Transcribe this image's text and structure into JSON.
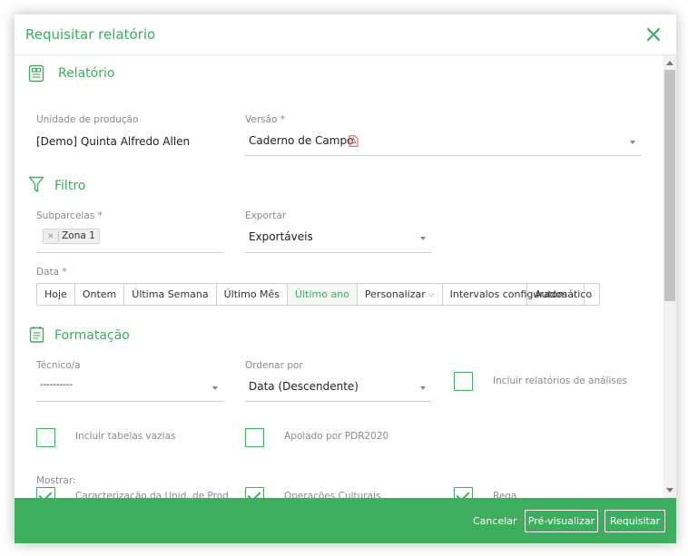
{
  "dialog": {
    "title": "Requisitar relatório"
  },
  "sections": {
    "relatorio": {
      "title": "Relatório",
      "unidade": {
        "label": "Unidade de produção",
        "value": "[Demo] Quinta Alfredo Allen"
      },
      "versao": {
        "label": "Versão *",
        "value": "Caderno de Campo"
      }
    },
    "filtro": {
      "title": "Filtro",
      "subparcelas": {
        "label": "Subparcelas *",
        "chip": "Zona 1"
      },
      "exportar": {
        "label": "Exportar",
        "value": "Exportáveis"
      },
      "data": {
        "label": "Data *",
        "buttons": [
          "Hoje",
          "Ontem",
          "Última Semana",
          "Último Mês",
          "Último ano",
          "Personalizar",
          "Intervalos configurados"
        ],
        "active": "Último ano",
        "auto": "Automático"
      }
    },
    "formatacao": {
      "title": "Formatação",
      "tecnico": {
        "label": "Técnico/a",
        "value": "----------"
      },
      "ordenar": {
        "label": "Ordenar por",
        "value": "Data (Descendente)"
      },
      "incluir_analises": "Incluir relatórios de análises",
      "incluir_tabelas": "Incluir tabelas vazias",
      "apoiado": "Apoiado por PDR2020",
      "mostrar": {
        "label": "Mostrar:",
        "items": [
          "Caracterização da Unid. de Prod.",
          "Operações Culturais",
          "Rega"
        ]
      }
    }
  },
  "footer": {
    "cancel": "Cancelar",
    "preview": "Pré-visualizar",
    "submit": "Requisitar"
  },
  "colors": {
    "accent": "#3cae5e",
    "pdf_icon": "#e04848"
  }
}
